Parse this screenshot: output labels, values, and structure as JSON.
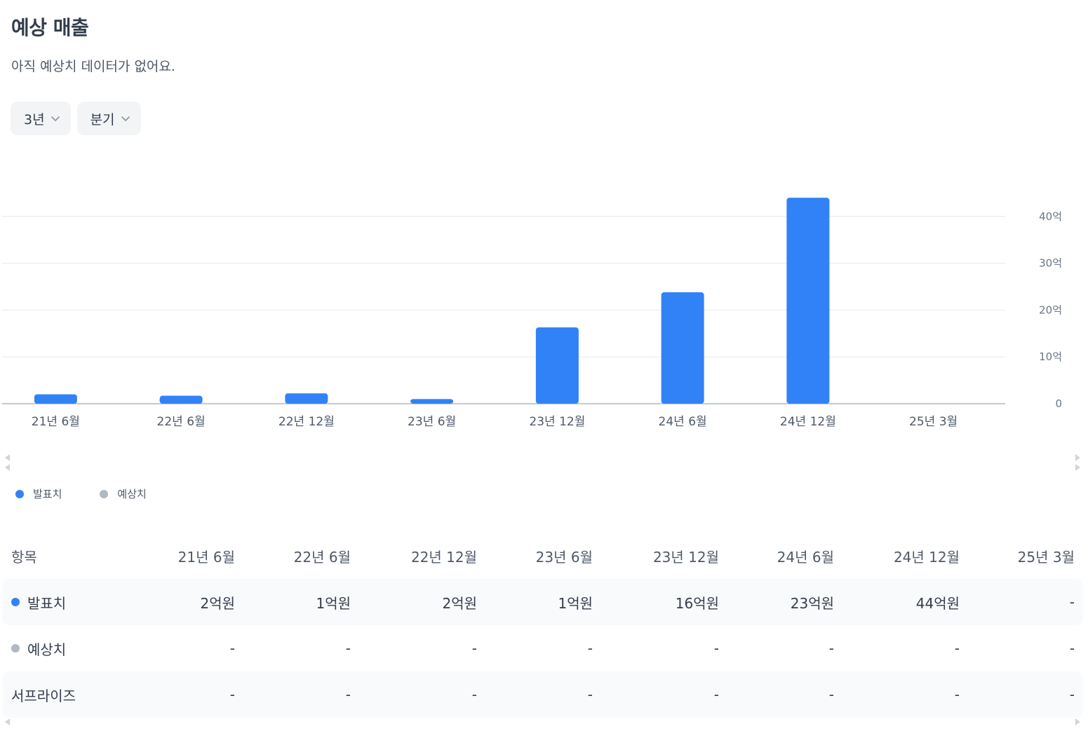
{
  "header": {
    "title": "예상 매출",
    "subtitle": "아직 예상치 데이터가 없어요."
  },
  "filters": {
    "period": "3년",
    "interval": "분기"
  },
  "colors": {
    "actual": "#3182f6",
    "estimate": "#b0b8c1",
    "grid": "#e5e8eb",
    "baseline": "#b0b8c1"
  },
  "chart_data": {
    "type": "bar",
    "categories": [
      "21년 6월",
      "22년 6월",
      "22년 12월",
      "23년 6월",
      "23년 12월",
      "24년 6월",
      "24년 12월",
      "25년 3월"
    ],
    "series": [
      {
        "name": "발표치",
        "values": [
          2,
          1.7,
          2.2,
          1,
          16.3,
          23.8,
          44,
          null
        ]
      },
      {
        "name": "예상치",
        "values": [
          null,
          null,
          null,
          null,
          null,
          null,
          null,
          null
        ]
      }
    ],
    "yticks": [
      "0",
      "10억",
      "20억",
      "30억",
      "40억"
    ],
    "ytick_values": [
      0,
      10,
      20,
      30,
      40
    ],
    "ylim": [
      0,
      46
    ],
    "grid": true,
    "y_axis_position": "right"
  },
  "legend": [
    {
      "label": "발표치",
      "color": "#3182f6"
    },
    {
      "label": "예상치",
      "color": "#b0b8c1"
    }
  ],
  "table": {
    "header_label": "항목",
    "columns": [
      "21년 6월",
      "22년 6월",
      "22년 12월",
      "23년 6월",
      "23년 12월",
      "24년 6월",
      "24년 12월",
      "25년 3월"
    ],
    "rows": [
      {
        "label": "발표치",
        "dot": "#3182f6",
        "values": [
          "2억원",
          "1억원",
          "2억원",
          "1억원",
          "16억원",
          "23억원",
          "44억원",
          "-"
        ]
      },
      {
        "label": "예상치",
        "dot": "#b0b8c1",
        "values": [
          "-",
          "-",
          "-",
          "-",
          "-",
          "-",
          "-",
          "-"
        ]
      },
      {
        "label": "서프라이즈",
        "dot": "",
        "values": [
          "-",
          "-",
          "-",
          "-",
          "-",
          "-",
          "-",
          "-"
        ]
      }
    ]
  }
}
